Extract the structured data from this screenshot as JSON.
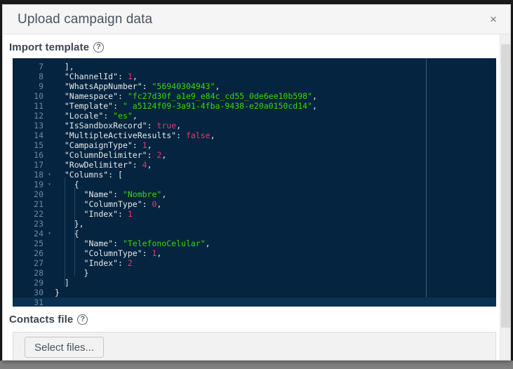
{
  "modal": {
    "title": "Upload campaign data",
    "close_icon": "close-icon",
    "close_label": "×"
  },
  "import_template": {
    "label": "Import template",
    "help_icon": "help-circle-icon",
    "editor": {
      "language": "json",
      "first_visible_line": 7,
      "last_visible_line": 31,
      "active_line": 31,
      "colors": {
        "background": "#04243f",
        "active_line": "#0b3152",
        "gutter_text": "#6b8aa3",
        "default_text": "#e8eaec",
        "string": "#3ad900",
        "number": "#e8376f",
        "boolean": "#e8376f",
        "ruler": "#3a5a75"
      },
      "lines": [
        {
          "n": 7,
          "fold": "",
          "indent": 2,
          "parts": [
            {
              "t": "],",
              "c": "punc"
            }
          ]
        },
        {
          "n": 8,
          "fold": "",
          "indent": 2,
          "parts": [
            {
              "t": "\"ChannelId\": ",
              "c": "punc"
            },
            {
              "t": "1",
              "c": "num"
            },
            {
              "t": ",",
              "c": "punc"
            }
          ]
        },
        {
          "n": 9,
          "fold": "",
          "indent": 2,
          "parts": [
            {
              "t": "\"WhatsAppNumber\": ",
              "c": "punc"
            },
            {
              "t": "\"56940304943\"",
              "c": "str"
            },
            {
              "t": ",",
              "c": "punc"
            }
          ]
        },
        {
          "n": 10,
          "fold": "",
          "indent": 2,
          "parts": [
            {
              "t": "\"Namespace\": ",
              "c": "punc"
            },
            {
              "t": "\"fc27d30f_a1e9_e84c_cd55_0de6ee10b598\"",
              "c": "str"
            },
            {
              "t": ",",
              "c": "punc"
            }
          ]
        },
        {
          "n": 11,
          "fold": "",
          "indent": 2,
          "parts": [
            {
              "t": "\"Template\": ",
              "c": "punc"
            },
            {
              "t": "\" a5124f09-3a91-4fba-9438-e20a0150cd14\"",
              "c": "str"
            },
            {
              "t": ",",
              "c": "punc"
            }
          ]
        },
        {
          "n": 12,
          "fold": "",
          "indent": 2,
          "parts": [
            {
              "t": "\"Locale\": ",
              "c": "punc"
            },
            {
              "t": "\"es\"",
              "c": "str"
            },
            {
              "t": ",",
              "c": "punc"
            }
          ]
        },
        {
          "n": 13,
          "fold": "",
          "indent": 2,
          "parts": [
            {
              "t": "\"IsSandboxRecord\": ",
              "c": "punc"
            },
            {
              "t": "true",
              "c": "bool"
            },
            {
              "t": ",",
              "c": "punc"
            }
          ]
        },
        {
          "n": 14,
          "fold": "",
          "indent": 2,
          "parts": [
            {
              "t": "\"MultipleActiveResults\": ",
              "c": "punc"
            },
            {
              "t": "false",
              "c": "bool"
            },
            {
              "t": ",",
              "c": "punc"
            }
          ]
        },
        {
          "n": 15,
          "fold": "",
          "indent": 2,
          "parts": [
            {
              "t": "\"CampaignType\": ",
              "c": "punc"
            },
            {
              "t": "1",
              "c": "num"
            },
            {
              "t": ",",
              "c": "punc"
            }
          ]
        },
        {
          "n": 16,
          "fold": "",
          "indent": 2,
          "parts": [
            {
              "t": "\"ColumnDelimiter\": ",
              "c": "punc"
            },
            {
              "t": "2",
              "c": "num"
            },
            {
              "t": ",",
              "c": "punc"
            }
          ]
        },
        {
          "n": 17,
          "fold": "",
          "indent": 2,
          "parts": [
            {
              "t": "\"RowDelimiter\": ",
              "c": "punc"
            },
            {
              "t": "4",
              "c": "num"
            },
            {
              "t": ",",
              "c": "punc"
            }
          ]
        },
        {
          "n": 18,
          "fold": "▾",
          "indent": 2,
          "parts": [
            {
              "t": "\"Columns\": [",
              "c": "punc"
            }
          ]
        },
        {
          "n": 19,
          "fold": "▾",
          "indent": 4,
          "parts": [
            {
              "t": "{",
              "c": "punc"
            }
          ]
        },
        {
          "n": 20,
          "fold": "",
          "indent": 6,
          "parts": [
            {
              "t": "\"Name\": ",
              "c": "punc"
            },
            {
              "t": "\"Nombre\"",
              "c": "str"
            },
            {
              "t": ",",
              "c": "punc"
            }
          ]
        },
        {
          "n": 21,
          "fold": "",
          "indent": 6,
          "parts": [
            {
              "t": "\"ColumnType\": ",
              "c": "punc"
            },
            {
              "t": "0",
              "c": "num"
            },
            {
              "t": ",",
              "c": "punc"
            }
          ]
        },
        {
          "n": 22,
          "fold": "",
          "indent": 6,
          "parts": [
            {
              "t": "\"Index\": ",
              "c": "punc"
            },
            {
              "t": "1",
              "c": "num"
            }
          ]
        },
        {
          "n": 23,
          "fold": "",
          "indent": 4,
          "parts": [
            {
              "t": "},",
              "c": "punc"
            }
          ]
        },
        {
          "n": 24,
          "fold": "▾",
          "indent": 4,
          "parts": [
            {
              "t": "{",
              "c": "punc"
            }
          ]
        },
        {
          "n": 25,
          "fold": "",
          "indent": 6,
          "parts": [
            {
              "t": "\"Name\": ",
              "c": "punc"
            },
            {
              "t": "\"TelefonoCelular\"",
              "c": "str"
            },
            {
              "t": ",",
              "c": "punc"
            }
          ]
        },
        {
          "n": 26,
          "fold": "",
          "indent": 6,
          "parts": [
            {
              "t": "\"ColumnType\": ",
              "c": "punc"
            },
            {
              "t": "1",
              "c": "num"
            },
            {
              "t": ",",
              "c": "punc"
            }
          ]
        },
        {
          "n": 27,
          "fold": "",
          "indent": 6,
          "parts": [
            {
              "t": "\"Index\": ",
              "c": "punc"
            },
            {
              "t": "2",
              "c": "num"
            }
          ]
        },
        {
          "n": 28,
          "fold": "",
          "indent": 6,
          "parts": [
            {
              "t": "}",
              "c": "punc"
            }
          ]
        },
        {
          "n": 29,
          "fold": "",
          "indent": 2,
          "parts": [
            {
              "t": "]",
              "c": "punc"
            }
          ]
        },
        {
          "n": 30,
          "fold": "",
          "indent": 0,
          "parts": [
            {
              "t": "}",
              "c": "punc"
            }
          ]
        },
        {
          "n": 31,
          "fold": "",
          "indent": 0,
          "parts": [
            {
              "t": "",
              "c": "punc"
            }
          ]
        }
      ]
    }
  },
  "contacts_file": {
    "label": "Contacts file",
    "help_icon": "help-circle-icon",
    "select_files_label": "Select files...",
    "selected_file_name": ""
  }
}
